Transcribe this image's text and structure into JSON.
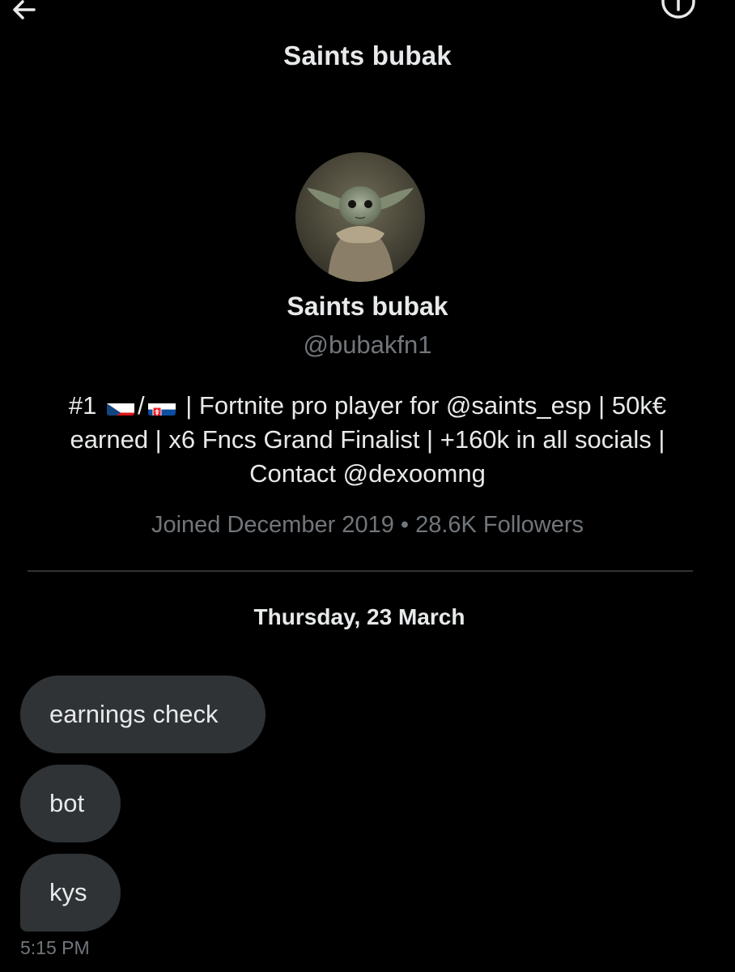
{
  "header": {
    "title": "Saints bubak",
    "back_icon": "arrow-left-icon",
    "info_icon": "info-circle-icon"
  },
  "profile": {
    "name": "Saints bubak",
    "handle": "@bubakfn1",
    "bio": {
      "prefix": "#1",
      "flag_1": "czech-flag",
      "separator": "/",
      "flag_2": "slovakia-flag",
      "text": "| Fortnite pro player for @saints_esp | 50k€ earned | x6 Fncs Grand Finalist | +160k in all socials | Contact @dexoomng"
    },
    "meta": "Joined December 2019 • 28.6K Followers"
  },
  "conversation": {
    "date": "Thursday, 23 March",
    "messages": [
      {
        "text": "earnings check"
      },
      {
        "text": "bot"
      },
      {
        "text": "kys"
      }
    ],
    "last_timestamp": "5:15 PM"
  },
  "colors": {
    "background": "#000000",
    "text_primary": "#e7e9ea",
    "text_secondary": "#71767b",
    "bubble": "#2f3336",
    "divider": "#2f3336"
  }
}
